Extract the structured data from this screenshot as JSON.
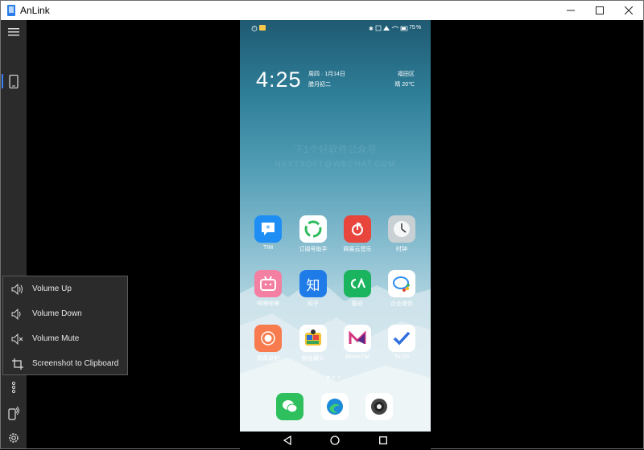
{
  "window": {
    "title": "AnLink",
    "controls": [
      "minimize",
      "maximize",
      "close"
    ]
  },
  "sidebar": {
    "items": [
      {
        "name": "menu-icon"
      },
      {
        "name": "phone-icon",
        "active": true
      },
      {
        "name": "more-icon"
      },
      {
        "name": "phone-remote-icon"
      },
      {
        "name": "settings-icon"
      }
    ],
    "accent": "#3b82f6"
  },
  "menu": {
    "items": [
      {
        "label": "Volume Up",
        "icon": "volume-up-icon"
      },
      {
        "label": "Volume Down",
        "icon": "volume-down-icon"
      },
      {
        "label": "Volume Mute",
        "icon": "volume-mute-icon"
      },
      {
        "label": "Screenshot to Clipboard",
        "icon": "crop-icon"
      }
    ]
  },
  "phone": {
    "status": {
      "battery": "75",
      "percent_sign": "%"
    },
    "time": "4:25",
    "date_line1": "周四 · 1月14日",
    "date_line2": "腊月初二",
    "location": "福田区",
    "weather": "晴  20℃",
    "watermark1": "下1个好软件公众号",
    "watermark2": "NEXTSOFT@WECHAT.COM",
    "apps": [
      {
        "label": "TIM",
        "color": "#1e8ef5",
        "icon": "tim-icon"
      },
      {
        "label": "订阅号助手",
        "color": "#ffffff",
        "icon": "subscription-assistant-icon"
      },
      {
        "label": "网易云音乐",
        "color": "#e8453c",
        "icon": "netease-music-icon"
      },
      {
        "label": "时钟",
        "color": "#c9d0d3",
        "icon": "clock-icon"
      },
      {
        "label": "哔哩哔哩",
        "color": "#f37fa3",
        "icon": "bilibili-icon"
      },
      {
        "label": "知乎",
        "color": "#1f7be8",
        "icon": "zhihu-icon"
      },
      {
        "label": "酷安",
        "color": "#19b45d",
        "icon": "coolapk-icon"
      },
      {
        "label": "企业微信",
        "color": "#ffffff",
        "icon": "wecom-icon"
      },
      {
        "label": "屏幕录制",
        "color": "#f77b4d",
        "icon": "screen-record-icon"
      },
      {
        "label": "鲸鱼罐头",
        "color": "#ffffff",
        "icon": "whale-can-icon"
      },
      {
        "label": "Moon FM",
        "color": "#ffffff",
        "icon": "moon-fm-icon"
      },
      {
        "label": "To Do",
        "color": "#ffffff",
        "icon": "todo-icon"
      }
    ],
    "dock": [
      {
        "icon": "wechat-icon",
        "color": "#2dc05c"
      },
      {
        "icon": "edge-icon",
        "color": "#ffffff"
      },
      {
        "icon": "camera-icon",
        "color": "#ffffff"
      }
    ],
    "page_dots": 3,
    "active_page": 0
  }
}
